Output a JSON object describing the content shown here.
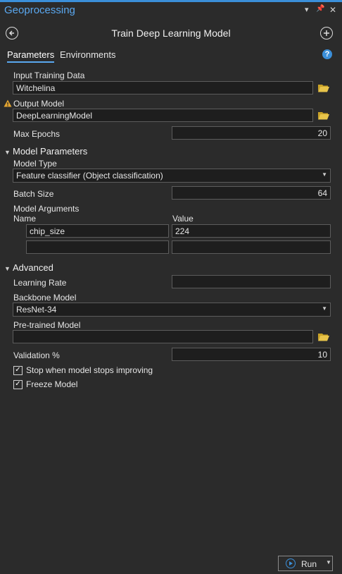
{
  "pane": {
    "title": "Geoprocessing",
    "accent": "#3b8fd9",
    "title_color": "#5aa8f0"
  },
  "tool": {
    "title": "Train Deep Learning Model"
  },
  "tabs": [
    {
      "label": "Parameters",
      "active": true
    },
    {
      "label": "Environments",
      "active": false
    }
  ],
  "params": {
    "input_training_data": {
      "label": "Input Training Data",
      "value": "Witchelina"
    },
    "output_model": {
      "label": "Output Model",
      "value": "DeepLearningModel",
      "warning": true
    },
    "max_epochs": {
      "label": "Max Epochs",
      "value": "20"
    }
  },
  "model_parameters": {
    "header": "Model Parameters",
    "model_type": {
      "label": "Model Type",
      "value": "Feature classifier (Object classification)"
    },
    "batch_size": {
      "label": "Batch Size",
      "value": "64"
    },
    "model_arguments": {
      "label": "Model Arguments",
      "name_header": "Name",
      "value_header": "Value",
      "rows": [
        {
          "name": "chip_size",
          "value": "224"
        },
        {
          "name": "",
          "value": ""
        }
      ]
    }
  },
  "advanced": {
    "header": "Advanced",
    "learning_rate": {
      "label": "Learning Rate",
      "value": ""
    },
    "backbone_model": {
      "label": "Backbone Model",
      "value": "ResNet-34"
    },
    "pretrained_model": {
      "label": "Pre-trained Model",
      "value": ""
    },
    "validation": {
      "label": "Validation %",
      "value": "10"
    },
    "stop_improving": {
      "label": "Stop when model stops improving",
      "checked": true
    },
    "freeze_model": {
      "label": "Freeze Model",
      "checked": true
    }
  },
  "run": {
    "label": "Run"
  }
}
